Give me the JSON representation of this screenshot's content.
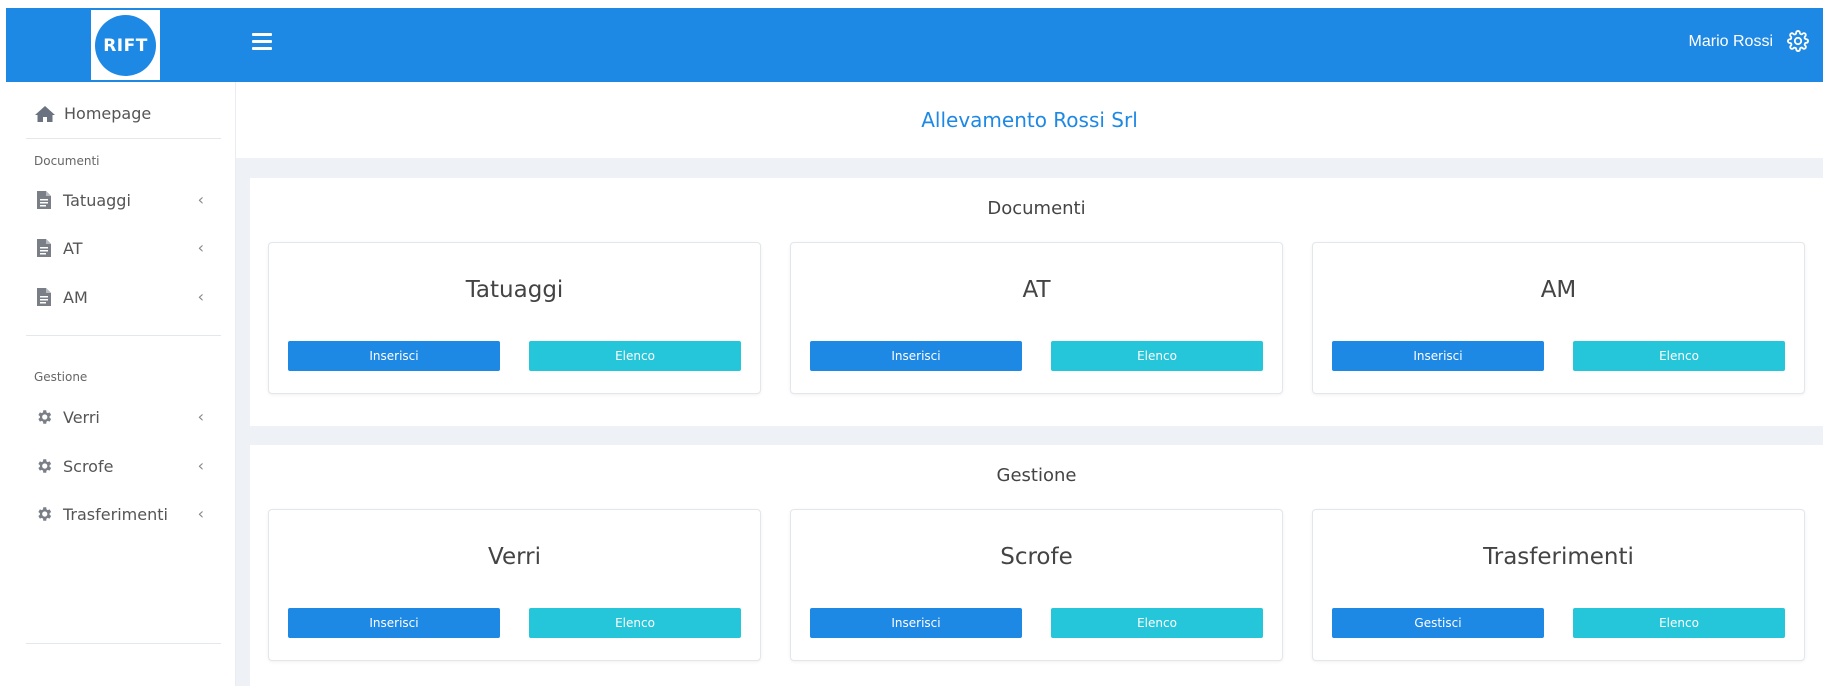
{
  "brand": {
    "logo_text": "RIFT"
  },
  "topbar": {
    "user_name": "Mario Rossi"
  },
  "sidebar": {
    "home_label": "Homepage",
    "sections": [
      {
        "title": "Documenti",
        "items": [
          {
            "label": "Tatuaggi",
            "icon": "file-icon"
          },
          {
            "label": "AT",
            "icon": "file-icon"
          },
          {
            "label": "AM",
            "icon": "file-icon"
          }
        ]
      },
      {
        "title": "Gestione",
        "items": [
          {
            "label": "Verri",
            "icon": "gear-icon"
          },
          {
            "label": "Scrofe",
            "icon": "gear-icon"
          },
          {
            "label": "Trasferimenti",
            "icon": "gear-icon"
          }
        ]
      }
    ],
    "chevron": "‹"
  },
  "main": {
    "page_title": "Allevamento Rossi Srl",
    "panels": [
      {
        "title": "Documenti",
        "cards": [
          {
            "title": "Tatuaggi",
            "primary": "Inserisci",
            "secondary": "Elenco"
          },
          {
            "title": "AT",
            "primary": "Inserisci",
            "secondary": "Elenco"
          },
          {
            "title": "AM",
            "primary": "Inserisci",
            "secondary": "Elenco"
          }
        ]
      },
      {
        "title": "Gestione",
        "cards": [
          {
            "title": "Verri",
            "primary": "Inserisci",
            "secondary": "Elenco"
          },
          {
            "title": "Scrofe",
            "primary": "Inserisci",
            "secondary": "Elenco"
          },
          {
            "title": "Trasferimenti",
            "primary": "Gestisci",
            "secondary": "Elenco"
          }
        ]
      }
    ]
  },
  "colors": {
    "primary": "#1e88e5",
    "info": "#26c6da",
    "background": "#eef1f5"
  }
}
